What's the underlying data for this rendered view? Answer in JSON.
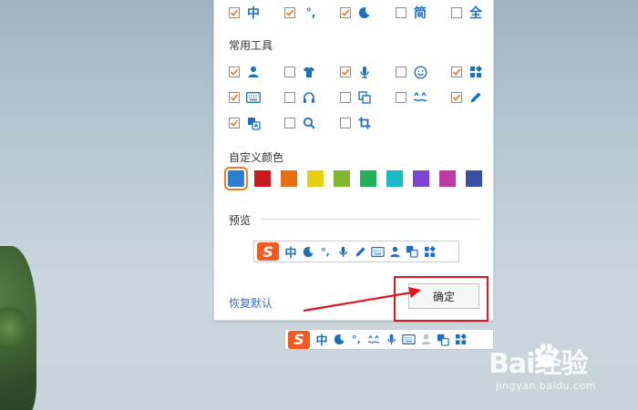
{
  "top_row": [
    {
      "checked": true,
      "icon": "zhong-icon",
      "glyph": "中"
    },
    {
      "checked": true,
      "icon": "punctuation-icon",
      "glyph": "°,"
    },
    {
      "checked": true,
      "icon": "moon-icon",
      "glyph": ""
    },
    {
      "checked": false,
      "icon": "jian-icon",
      "glyph": "简"
    },
    {
      "checked": false,
      "icon": "quan-icon",
      "glyph": "全"
    }
  ],
  "tools": {
    "heading": "常用工具",
    "items": [
      {
        "checked": true,
        "icon": "user-icon"
      },
      {
        "checked": false,
        "icon": "tshirt-icon"
      },
      {
        "checked": true,
        "icon": "microphone-icon"
      },
      {
        "checked": false,
        "icon": "smiley-icon"
      },
      {
        "checked": true,
        "icon": "grid-icon"
      },
      {
        "checked": true,
        "icon": "keyboard-icon"
      },
      {
        "checked": false,
        "icon": "headphones-icon"
      },
      {
        "checked": false,
        "icon": "copy-icon"
      },
      {
        "checked": false,
        "icon": "symbols-icon"
      },
      {
        "checked": true,
        "icon": "pencil-icon"
      },
      {
        "checked": true,
        "icon": "translate-icon"
      },
      {
        "checked": false,
        "icon": "magnifier-icon"
      },
      {
        "checked": false,
        "icon": "crop-icon"
      }
    ]
  },
  "colors": {
    "heading": "自定义颜色",
    "swatches": [
      "#2d7fce",
      "#c9191e",
      "#e86f0f",
      "#e4d10f",
      "#7fb62b",
      "#22b05b",
      "#1ab9c6",
      "#7d43d3",
      "#c03aa5",
      "#3a4fa2"
    ],
    "selected_index": 0
  },
  "preview": {
    "heading": "预览"
  },
  "footer": {
    "reset_label": "恢复默认",
    "ok_label": "确定"
  },
  "watermark": {
    "brand": "Bai经验",
    "url": "jingyan.baidu.com"
  },
  "accent": "#1f6fbf"
}
